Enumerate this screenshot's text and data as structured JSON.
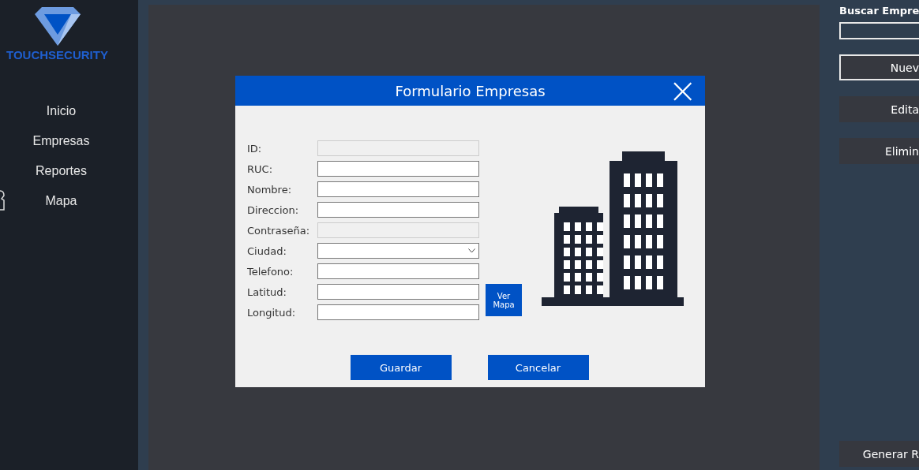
{
  "sidebar": {
    "logo_text": "TOUCHSECURITY",
    "items": [
      {
        "label": "Inicio"
      },
      {
        "label": "Empresas"
      },
      {
        "label": "Reportes"
      },
      {
        "label": "Mapa"
      }
    ]
  },
  "dialog": {
    "title": "Formulario Empresas",
    "close": "×",
    "fields": [
      {
        "label": "ID:",
        "kind": "text",
        "disabled": true
      },
      {
        "label": "RUC:",
        "kind": "text",
        "disabled": false
      },
      {
        "label": "Nombre:",
        "kind": "text",
        "disabled": false
      },
      {
        "label": "Direccion:",
        "kind": "text",
        "disabled": false
      },
      {
        "label": "Contraseña:",
        "kind": "text",
        "disabled": true
      },
      {
        "label": "Ciudad:",
        "kind": "select",
        "disabled": false
      },
      {
        "label": "Telefono:",
        "kind": "text",
        "disabled": false
      },
      {
        "label": "Latitud:",
        "kind": "text",
        "disabled": false
      },
      {
        "label": "Longitud:",
        "kind": "text",
        "disabled": false
      }
    ],
    "map_button": "Ver Mapa",
    "buttons": [
      "Guardar",
      "Cancelar"
    ]
  },
  "right_panel": {
    "search_label": "Buscar Empre",
    "buttons": [
      {
        "label": "Nuev",
        "outlined": true
      },
      {
        "label": "Edita",
        "outlined": false
      },
      {
        "label": "Elimin",
        "outlined": false
      }
    ],
    "report_button": "Generar R"
  }
}
